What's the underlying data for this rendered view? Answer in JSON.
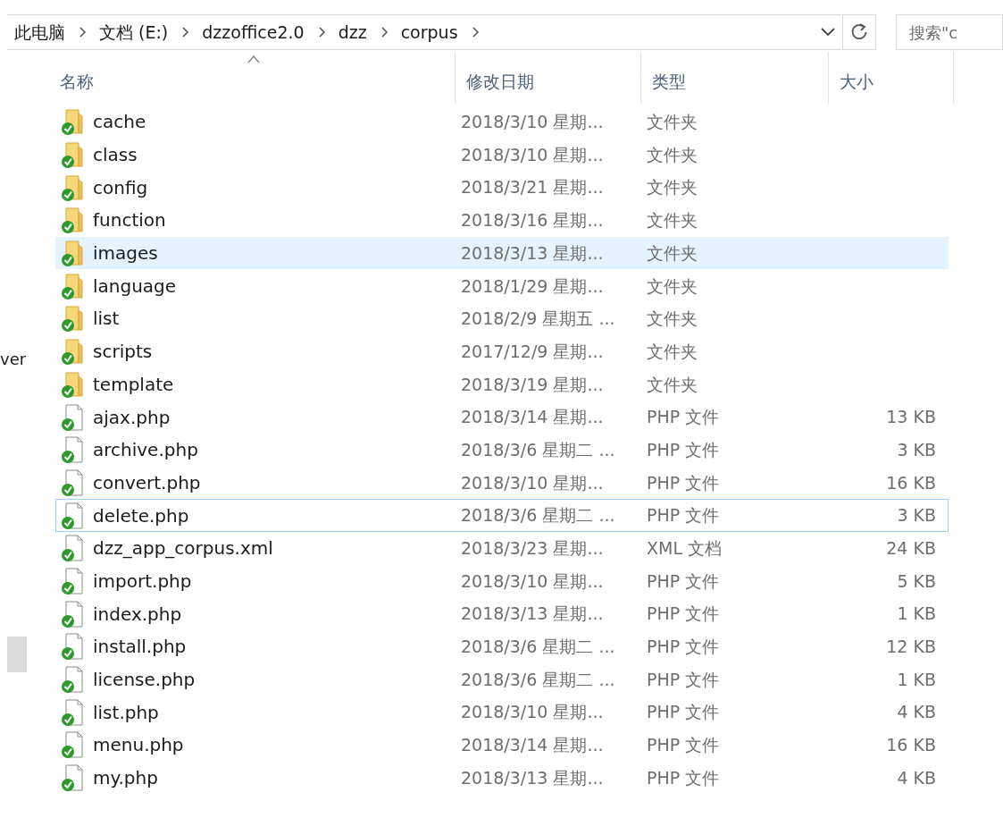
{
  "address_bar": {
    "breadcrumbs": [
      "此电脑",
      "文档 (E:)",
      "dzzoffice2.0",
      "dzz",
      "corpus"
    ]
  },
  "search": {
    "placeholder": "搜索\"c"
  },
  "nav_pane": {
    "partial_label": "ver"
  },
  "table": {
    "columns": [
      {
        "label": "名称",
        "sorted": true
      },
      {
        "label": "修改日期",
        "sorted": false
      },
      {
        "label": "类型",
        "sorted": false
      },
      {
        "label": "大小",
        "sorted": false
      }
    ],
    "rows": [
      {
        "kind": "folder",
        "name": "cache",
        "date": "2018/3/10 星期...",
        "type": "文件夹",
        "hovered": false,
        "focused": false
      },
      {
        "kind": "folder",
        "name": "class",
        "date": "2018/3/10 星期...",
        "type": "文件夹",
        "hovered": false,
        "focused": false
      },
      {
        "kind": "folder",
        "name": "config",
        "date": "2018/3/21 星期...",
        "type": "文件夹",
        "hovered": false,
        "focused": false
      },
      {
        "kind": "folder",
        "name": "function",
        "date": "2018/3/16 星期...",
        "type": "文件夹",
        "hovered": false,
        "focused": false
      },
      {
        "kind": "folder",
        "name": "images",
        "date": "2018/3/13 星期...",
        "type": "文件夹",
        "hovered": true,
        "focused": false
      },
      {
        "kind": "folder",
        "name": "language",
        "date": "2018/1/29 星期...",
        "type": "文件夹",
        "hovered": false,
        "focused": false
      },
      {
        "kind": "folder",
        "name": "list",
        "date": "2018/2/9 星期五 ...",
        "type": "文件夹",
        "hovered": false,
        "focused": false
      },
      {
        "kind": "folder",
        "name": "scripts",
        "date": "2017/12/9 星期...",
        "type": "文件夹",
        "hovered": false,
        "focused": false
      },
      {
        "kind": "folder",
        "name": "template",
        "date": "2018/3/19 星期...",
        "type": "文件夹",
        "hovered": false,
        "focused": false
      },
      {
        "kind": "file",
        "name": "ajax.php",
        "date": "2018/3/14 星期...",
        "type": "PHP 文件",
        "size": "13 KB",
        "hovered": false,
        "focused": false
      },
      {
        "kind": "file",
        "name": "archive.php",
        "date": "2018/3/6 星期二 ...",
        "type": "PHP 文件",
        "size": "3 KB",
        "hovered": false,
        "focused": false
      },
      {
        "kind": "file",
        "name": "convert.php",
        "date": "2018/3/10 星期...",
        "type": "PHP 文件",
        "size": "16 KB",
        "hovered": false,
        "focused": false
      },
      {
        "kind": "file",
        "name": "delete.php",
        "date": "2018/3/6 星期二 ...",
        "type": "PHP 文件",
        "size": "3 KB",
        "hovered": false,
        "focused": true
      },
      {
        "kind": "file",
        "name": "dzz_app_corpus.xml",
        "date": "2018/3/23 星期...",
        "type": "XML 文档",
        "size": "24 KB",
        "hovered": false,
        "focused": false
      },
      {
        "kind": "file",
        "name": "import.php",
        "date": "2018/3/10 星期...",
        "type": "PHP 文件",
        "size": "5 KB",
        "hovered": false,
        "focused": false
      },
      {
        "kind": "file",
        "name": "index.php",
        "date": "2018/3/13 星期...",
        "type": "PHP 文件",
        "size": "1 KB",
        "hovered": false,
        "focused": false
      },
      {
        "kind": "file",
        "name": "install.php",
        "date": "2018/3/6 星期二 ...",
        "type": "PHP 文件",
        "size": "12 KB",
        "hovered": false,
        "focused": false
      },
      {
        "kind": "file",
        "name": "license.php",
        "date": "2018/3/6 星期二 ...",
        "type": "PHP 文件",
        "size": "1 KB",
        "hovered": false,
        "focused": false
      },
      {
        "kind": "file",
        "name": "list.php",
        "date": "2018/3/10 星期...",
        "type": "PHP 文件",
        "size": "4 KB",
        "hovered": false,
        "focused": false
      },
      {
        "kind": "file",
        "name": "menu.php",
        "date": "2018/3/14 星期...",
        "type": "PHP 文件",
        "size": "16 KB",
        "hovered": false,
        "focused": false
      },
      {
        "kind": "file",
        "name": "my.php",
        "date": "2018/3/13 星期...",
        "type": "PHP 文件",
        "size": "4 KB",
        "hovered": false,
        "focused": false
      }
    ]
  }
}
